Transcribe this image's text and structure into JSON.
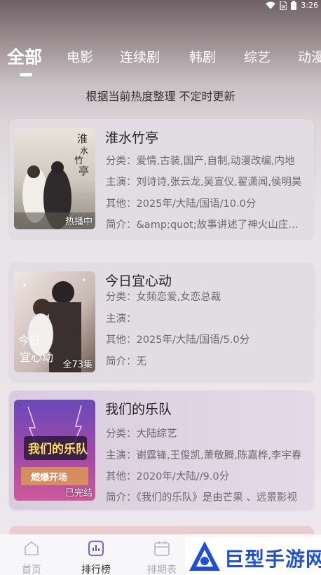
{
  "status_bar": {
    "time": "3:26"
  },
  "tabs": [
    {
      "label": "全部",
      "active": true
    },
    {
      "label": "电影",
      "active": false
    },
    {
      "label": "连续剧",
      "active": false
    },
    {
      "label": "韩剧",
      "active": false
    },
    {
      "label": "综艺",
      "active": false
    },
    {
      "label": "动漫",
      "active": false
    }
  ],
  "subtitle": "根据当前热度整理 不定时更新",
  "cards": [
    {
      "title": "淮水竹亭",
      "badge": "热播中",
      "category": "分类：爱情,古装,国产,自制,动漫改编,内地",
      "cast": "主演：刘诗诗,张云龙,吴宣仪,翟潇闻,侯明昊",
      "other": "其他：2025年/大陆/国语/10.0分",
      "intro": "简介：&amp;quot;故事讲述了神火山庄少庄主",
      "poster_text": "淮水竹亭"
    },
    {
      "title": "今日宜心动",
      "badge": "全73集",
      "category": "分类：女频恋爱,女恋总裁",
      "cast": "主演：",
      "other": "其他：2025年/大陆/国语/5.0分",
      "intro": "简介：无",
      "poster_text": "今日宜心动"
    },
    {
      "title": "我们的乐队",
      "badge": "已完结",
      "category": "分类：大陆综艺",
      "cast": "主演：谢霆锋,王俊凯,萧敬腾,陈嘉桦,李宇春",
      "other": "其他：2020年/大陆//9.0分",
      "intro": "简介：《我们的乐队》是由芒果 、远景影视",
      "poster_text": "我们的乐队"
    }
  ],
  "bottom_nav": [
    {
      "label": "首页",
      "icon": "home-icon",
      "active": false
    },
    {
      "label": "排行榜",
      "icon": "chart-icon",
      "active": true
    },
    {
      "label": "排期表",
      "icon": "calendar-icon",
      "active": false
    }
  ],
  "watermark": {
    "text": "巨型手游网"
  },
  "colors": {
    "accent": "#6b4fd8",
    "watermark_blue": "#1f4fd6"
  }
}
